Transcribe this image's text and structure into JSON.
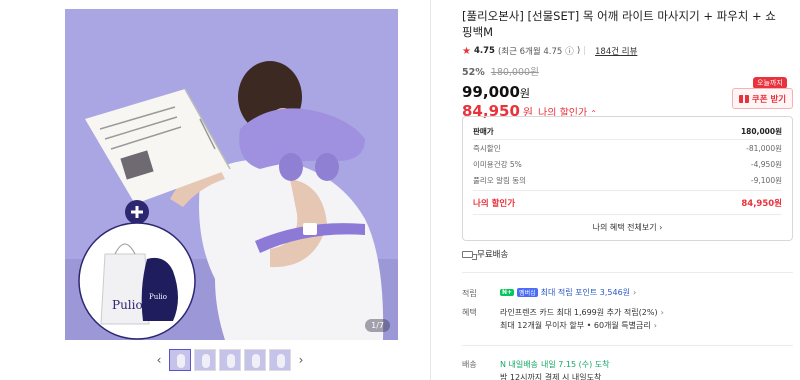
{
  "gallery": {
    "page_counter": "1/7",
    "thumb_count": 5,
    "prev_icon": "chevron-left",
    "next_icon": "chevron-right",
    "bag_brand": "Pulio",
    "pouch_brand": "Pulio"
  },
  "product": {
    "title": "[풀리오본사] [선물SET] 목 어깨 라이트 마사지기 + 파우치 + 쇼핑백M",
    "rating": "4.75",
    "rating_recent": "(최근 6개월 4.75",
    "rating_info_icon": "ⓘ",
    "rating_recent_close": ")",
    "review_count": "184건 리뷰"
  },
  "price": {
    "discount_rate": "52%",
    "original": "180,000원",
    "sale": "99,000",
    "sale_unit": "원",
    "my_price": "84,950",
    "my_price_unit": "원",
    "my_price_label": "나의 할인가",
    "coupon_badge": "오늘까지",
    "coupon_button": "쿠폰 받기"
  },
  "price_detail": {
    "rows": [
      {
        "label": "판매가",
        "value": "180,000원"
      },
      {
        "label": "즉시할인",
        "value": "-81,000원"
      },
      {
        "label": "이미용건강 5%",
        "value": "-4,950원"
      },
      {
        "label": "풀리오 알림 동의",
        "value": "-9,100원"
      }
    ],
    "my_label": "나의 할인가",
    "my_value": "84,950원",
    "more": "나의 혜택 전체보기"
  },
  "shipping_free": "무료배송",
  "points": {
    "label": "적립",
    "badge_n": "N+",
    "badge_pay": "멤버십",
    "text": "최대 적립 포인트 3,546원"
  },
  "benefits": {
    "label": "혜택",
    "line1": "라인프렌즈 카드 최대 1,699원 추가 적립(2%)",
    "line2": "최대 12개월 무이자 할부 • 60개월 특별금리"
  },
  "delivery": {
    "label": "배송",
    "badge": "N 내일배송",
    "text": "내일 7.15 (수) 도착",
    "sub": "밤 12시까지 결제 시 내일도착"
  },
  "colors": {
    "accent_red": "#e8323c",
    "point_blue": "#2a56c6",
    "delivery_green": "#13a863",
    "image_bg": "#aaa6e3"
  }
}
